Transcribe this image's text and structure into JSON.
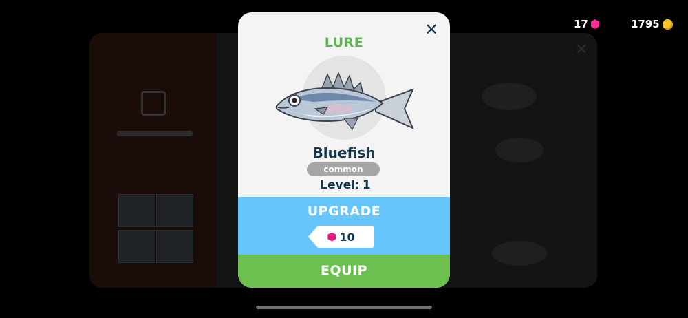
{
  "currency": {
    "gems": "17",
    "coins": "1795",
    "gem_color": "#ff2b9a",
    "coin_color": "#f7c32a"
  },
  "modal": {
    "title": "LURE",
    "close_icon": "close-icon",
    "item": {
      "name": "Bluefish",
      "rarity": "common",
      "level_label": "Level:",
      "level_value": "1",
      "icon": "bluefish-image"
    },
    "upgrade": {
      "label": "UPGRADE",
      "cost": "10",
      "cost_icon": "gem-icon",
      "color": "#66c6fb"
    },
    "equip": {
      "label": "EQUIP",
      "color": "#6dbf50"
    },
    "title_color": "#5fb24e"
  }
}
